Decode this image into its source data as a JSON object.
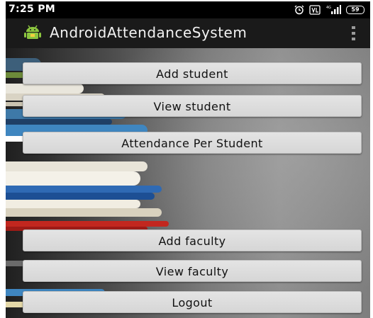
{
  "status_bar": {
    "time": "7:25 PM",
    "battery": "59",
    "icons": [
      "alarm-icon",
      "volte-icon",
      "signal-icon",
      "battery-icon"
    ]
  },
  "action_bar": {
    "title": "AndroidAttendanceSystem",
    "logo_icon": "android-icon",
    "menu_icon": "overflow-menu-icon"
  },
  "menu": {
    "add_student": "Add student",
    "view_student": "View student",
    "attendance_per_student": "Attendance Per Student",
    "add_faculty": "Add faculty",
    "view_faculty": "View faculty",
    "logout": "Logout"
  },
  "colors": {
    "status_bar_bg": "#000000",
    "action_bar_bg": "#1a1a1a",
    "android_green": "#8cc63f",
    "button_bg": "#dcdcdc"
  }
}
